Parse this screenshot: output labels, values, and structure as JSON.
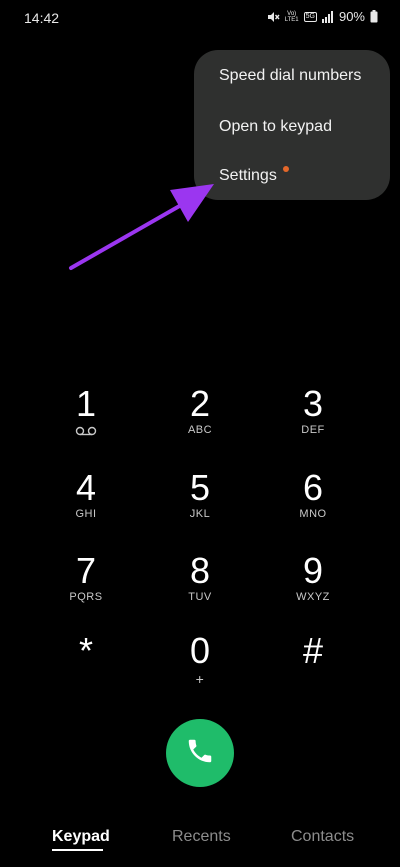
{
  "status": {
    "time": "14:42",
    "volte_top": "Vo)",
    "volte_bottom": "LTE1",
    "network": "5G",
    "battery": "90%"
  },
  "menu": {
    "items": [
      {
        "label": "Speed dial numbers"
      },
      {
        "label": "Open to keypad"
      },
      {
        "label": "Settings"
      }
    ],
    "dot_color": "#e4672a"
  },
  "annotation": {
    "arrow_color": "#9b36f0"
  },
  "keypad": {
    "keys": [
      {
        "digit": "1",
        "letters": ""
      },
      {
        "digit": "2",
        "letters": "ABC"
      },
      {
        "digit": "3",
        "letters": "DEF"
      },
      {
        "digit": "4",
        "letters": "GHI"
      },
      {
        "digit": "5",
        "letters": "JKL"
      },
      {
        "digit": "6",
        "letters": "MNO"
      },
      {
        "digit": "7",
        "letters": "PQRS"
      },
      {
        "digit": "8",
        "letters": "TUV"
      },
      {
        "digit": "9",
        "letters": "WXYZ"
      },
      {
        "digit": "*",
        "letters": ""
      },
      {
        "digit": "0",
        "letters": "+"
      },
      {
        "digit": "#",
        "letters": ""
      }
    ]
  },
  "call_button": {
    "icon": "phone-icon",
    "color": "#1fbc6a"
  },
  "tabs": [
    {
      "label": "Keypad",
      "active": true
    },
    {
      "label": "Recents",
      "active": false
    },
    {
      "label": "Contacts",
      "active": false
    }
  ]
}
